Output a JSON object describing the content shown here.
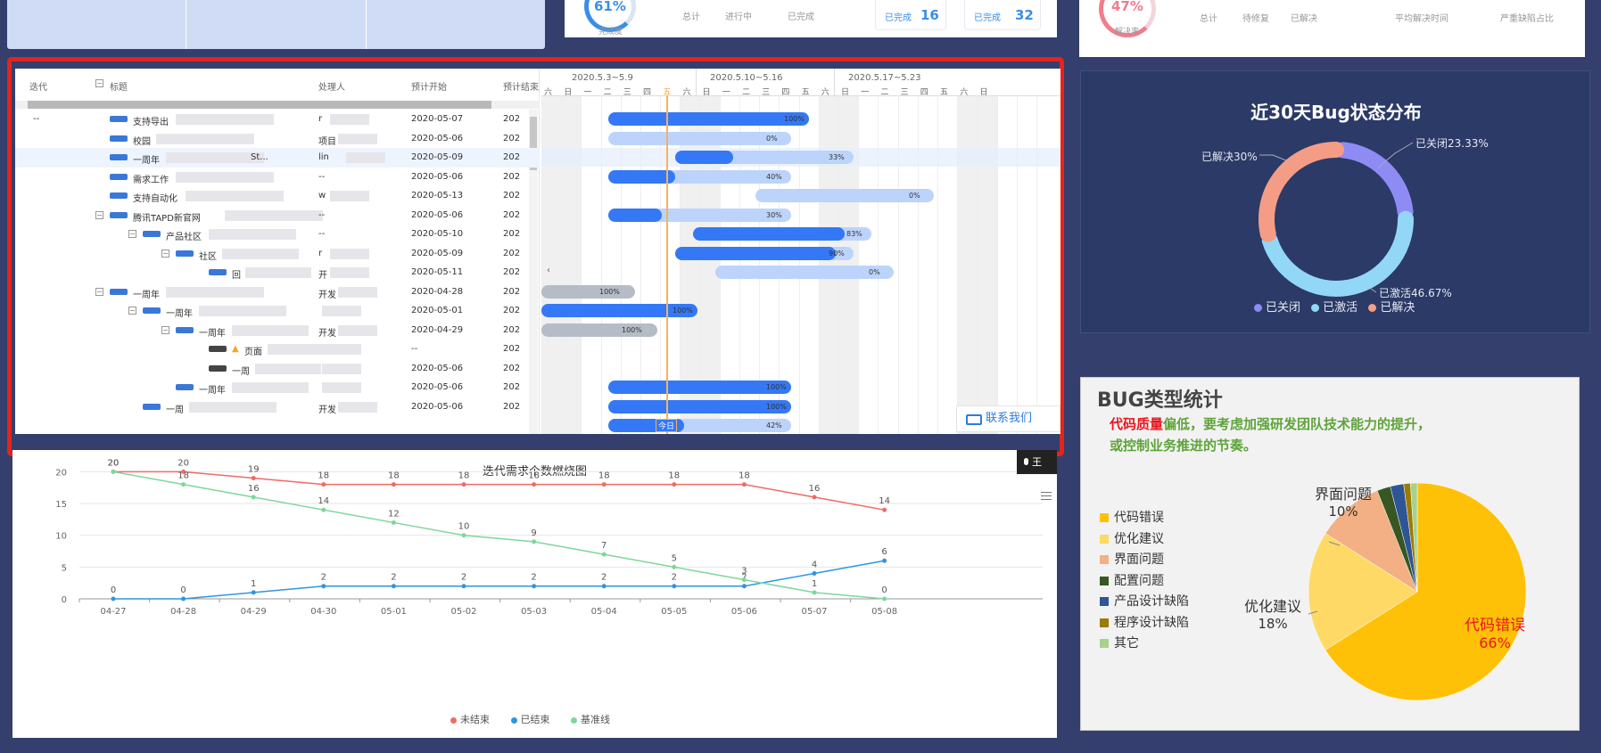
{
  "top_left_panel": {},
  "top_mid_card": {
    "progress_percent": "61%",
    "progress_label": "完成度",
    "stats": [
      {
        "label": "总计"
      },
      {
        "label": "进行中"
      },
      {
        "label": "已完成"
      }
    ],
    "chips": [
      {
        "label": "已完成",
        "value": "16"
      },
      {
        "label": "已完成",
        "value": "32"
      }
    ]
  },
  "top_right_card": {
    "progress_percent": "47%",
    "progress_label": "解决率",
    "stats": [
      {
        "label": "总计"
      },
      {
        "label": "待修复"
      },
      {
        "label": "已解决"
      },
      {
        "label": "平均解决时间"
      },
      {
        "label": "严重缺陷占比"
      }
    ]
  },
  "gantt": {
    "columns": [
      "迭代",
      "标题",
      "处理人",
      "预计开始",
      "预计结束"
    ],
    "weeks": [
      "2020.5.3~5.9",
      "2020.5.10~5.16",
      "2020.5.17~5.23"
    ],
    "day_labels": [
      "六",
      "日",
      "一",
      "二",
      "三",
      "四",
      "五",
      "六",
      "日",
      "一",
      "二",
      "三",
      "四",
      "五",
      "六",
      "日",
      "一",
      "二",
      "三",
      "四",
      "五",
      "六",
      "日"
    ],
    "today_label": "今日",
    "contact_label": "联系我们",
    "rows": [
      {
        "iter": "--",
        "title": "支持导出",
        "owner": "r",
        "start": "2020-05-07",
        "end": "202",
        "tag": "STORY",
        "indent": 0
      },
      {
        "iter": "",
        "title": "校园",
        "owner": "项目",
        "start": "2020-05-06",
        "end": "202",
        "tag": "STORY",
        "indent": 0
      },
      {
        "iter": "",
        "title": "一周年",
        "owner": "lin",
        "start": "2020-05-09",
        "end": "202",
        "tag": "STORY",
        "indent": 0,
        "extra": "St..."
      },
      {
        "iter": "",
        "title": "需求工作",
        "owner": "--",
        "start": "2020-05-06",
        "end": "202",
        "tag": "STORY",
        "indent": 0
      },
      {
        "iter": "",
        "title": "支持自动化",
        "owner": "w",
        "start": "2020-05-13",
        "end": "202",
        "tag": "STORY",
        "indent": 0
      },
      {
        "iter": "",
        "title": "腾讯TAPD新官网",
        "owner": "--",
        "start": "2020-05-06",
        "end": "202",
        "tag": "STORY",
        "indent": 0,
        "exp": true
      },
      {
        "iter": "",
        "title": "产品社区",
        "owner": "--",
        "start": "2020-05-10",
        "end": "202",
        "tag": "STORY",
        "indent": 1,
        "exp": true
      },
      {
        "iter": "",
        "title": "社区",
        "owner": "r",
        "start": "2020-05-09",
        "end": "202",
        "tag": "STORY",
        "indent": 2,
        "exp": true
      },
      {
        "iter": "",
        "title": "回",
        "owner": "开",
        "start": "2020-05-11",
        "end": "202",
        "tag": "STORY",
        "indent": 3
      },
      {
        "iter": "",
        "title": "一周年",
        "owner": "开发",
        "start": "2020-04-28",
        "end": "202",
        "tag": "STORY",
        "indent": 0,
        "exp": true
      },
      {
        "iter": "",
        "title": "一周年",
        "owner": "",
        "start": "2020-05-01",
        "end": "202",
        "tag": "STORY",
        "indent": 1,
        "exp": true
      },
      {
        "iter": "",
        "title": "一周年",
        "owner": "开发",
        "start": "2020-04-29",
        "end": "202",
        "tag": "STORY",
        "indent": 2,
        "exp": true
      },
      {
        "iter": "",
        "title": "页面",
        "owner": "",
        "start": "--",
        "end": "202",
        "tag": "TASK",
        "indent": 3,
        "warn": true
      },
      {
        "iter": "",
        "title": "一周",
        "owner": "",
        "start": "2020-05-06",
        "end": "202",
        "tag": "TASK",
        "indent": 3
      },
      {
        "iter": "",
        "title": "一周年",
        "owner": "",
        "start": "2020-05-06",
        "end": "202",
        "tag": "STORY",
        "indent": 2
      },
      {
        "iter": "",
        "title": "一周",
        "owner": "开发",
        "start": "2020-05-06",
        "end": "202",
        "tag": "STORY",
        "indent": 1
      }
    ],
    "bars": [
      {
        "row": 0,
        "bg": [
          75,
          300
        ],
        "fg": [
          75,
          300
        ],
        "label": "100%"
      },
      {
        "row": 1,
        "bg": [
          75,
          280
        ],
        "fg": null,
        "label": "0%"
      },
      {
        "row": 2,
        "bg": [
          150,
          350
        ],
        "fg": [
          150,
          215
        ],
        "label": "33%"
      },
      {
        "row": 3,
        "bg": [
          75,
          280
        ],
        "fg": [
          75,
          150
        ],
        "label": "40%"
      },
      {
        "row": 4,
        "bg": [
          240,
          440
        ],
        "fg": null,
        "label": "0%"
      },
      {
        "row": 5,
        "bg": [
          75,
          280
        ],
        "fg": [
          75,
          135
        ],
        "label": "30%"
      },
      {
        "row": 6,
        "bg": [
          170,
          370
        ],
        "fg": [
          170,
          340
        ],
        "label": "83%"
      },
      {
        "row": 7,
        "bg": [
          150,
          350
        ],
        "fg": [
          150,
          330
        ],
        "label": "90%"
      },
      {
        "row": 8,
        "bg": [
          195,
          395
        ],
        "fg": null,
        "label": "0%"
      },
      {
        "row": 9,
        "gray": [
          0,
          105
        ],
        "label": "100%"
      },
      {
        "row": 10,
        "bg": [
          0,
          175
        ],
        "fg": [
          0,
          175
        ],
        "label": "100%"
      },
      {
        "row": 11,
        "gray": [
          0,
          130
        ],
        "label": "100%"
      },
      {
        "row": 14,
        "bg": [
          75,
          280
        ],
        "fg": [
          75,
          280
        ],
        "label": "100%"
      },
      {
        "row": 15,
        "bg": [
          75,
          280
        ],
        "fg": [
          75,
          280
        ],
        "label": "100%"
      },
      {
        "row": 16,
        "bg": [
          75,
          280
        ],
        "fg": [
          75,
          160
        ],
        "label": "42%"
      }
    ]
  },
  "donut": {
    "title": "近30天Bug状态分布",
    "labels": [
      "已关闭23.33%",
      "已激活46.67%",
      "已解决30%"
    ],
    "legend": [
      {
        "name": "已关闭",
        "color": "#8f8bf4"
      },
      {
        "name": "已激活",
        "color": "#93d7f7"
      },
      {
        "name": "已解决",
        "color": "#f59c86"
      }
    ],
    "chart_data": {
      "type": "pie",
      "categories": [
        "已关闭",
        "已激活",
        "已解决"
      ],
      "values": [
        23.33,
        46.67,
        30
      ]
    }
  },
  "burndown": {
    "title": "迭代需求个数燃烧图",
    "legend": [
      {
        "name": "未结束",
        "color": "#ef6b64"
      },
      {
        "name": "已结束",
        "color": "#2f95e0"
      },
      {
        "name": "基准线",
        "color": "#7ed79a"
      }
    ],
    "chart_data": {
      "type": "line",
      "x": [
        "04-27",
        "04-28",
        "04-29",
        "04-30",
        "05-01",
        "05-02",
        "05-03",
        "05-04",
        "05-05",
        "05-06",
        "05-07",
        "05-08"
      ],
      "ylim": [
        0,
        25
      ],
      "yticks": [
        0,
        5,
        10,
        15,
        20,
        25
      ],
      "series": [
        {
          "name": "未结束",
          "values": [
            20,
            20,
            19,
            18,
            18,
            18,
            18,
            18,
            18,
            18,
            16,
            14
          ]
        },
        {
          "name": "已结束",
          "values": [
            0,
            0,
            1,
            2,
            2,
            2,
            2,
            2,
            2,
            2,
            4,
            6
          ]
        },
        {
          "name": "基准线",
          "values": [
            20,
            18,
            16,
            14,
            12,
            10,
            9,
            7,
            5,
            3,
            1,
            0
          ]
        }
      ]
    },
    "recorder_label": "王"
  },
  "bug_types": {
    "title": "BUG类型统计",
    "note_red": "代码质量",
    "note_rest": "偏低，要考虑加强研发团队技术能力的提升，",
    "note_line2": "或控制业务推进的节奏。",
    "legend": [
      {
        "name": "代码错误",
        "color": "#ffc107"
      },
      {
        "name": "优化建议",
        "color": "#ffd966"
      },
      {
        "name": "界面问题",
        "color": "#f2b084"
      },
      {
        "name": "配置问题",
        "color": "#375623"
      },
      {
        "name": "产品设计缺陷",
        "color": "#2f5597"
      },
      {
        "name": "程序设计缺陷",
        "color": "#9c7c00"
      },
      {
        "name": "其它",
        "color": "#a9d18e"
      }
    ],
    "callouts": [
      {
        "name": "代码错误",
        "pct": "66%"
      },
      {
        "name": "优化建议",
        "pct": "18%"
      },
      {
        "name": "界面问题",
        "pct": "10%"
      }
    ],
    "chart_data": {
      "type": "pie",
      "categories": [
        "代码错误",
        "优化建议",
        "界面问题",
        "配置问题",
        "产品设计缺陷",
        "程序设计缺陷",
        "其它"
      ],
      "values": [
        66,
        18,
        10,
        2,
        2,
        1,
        1
      ]
    }
  }
}
